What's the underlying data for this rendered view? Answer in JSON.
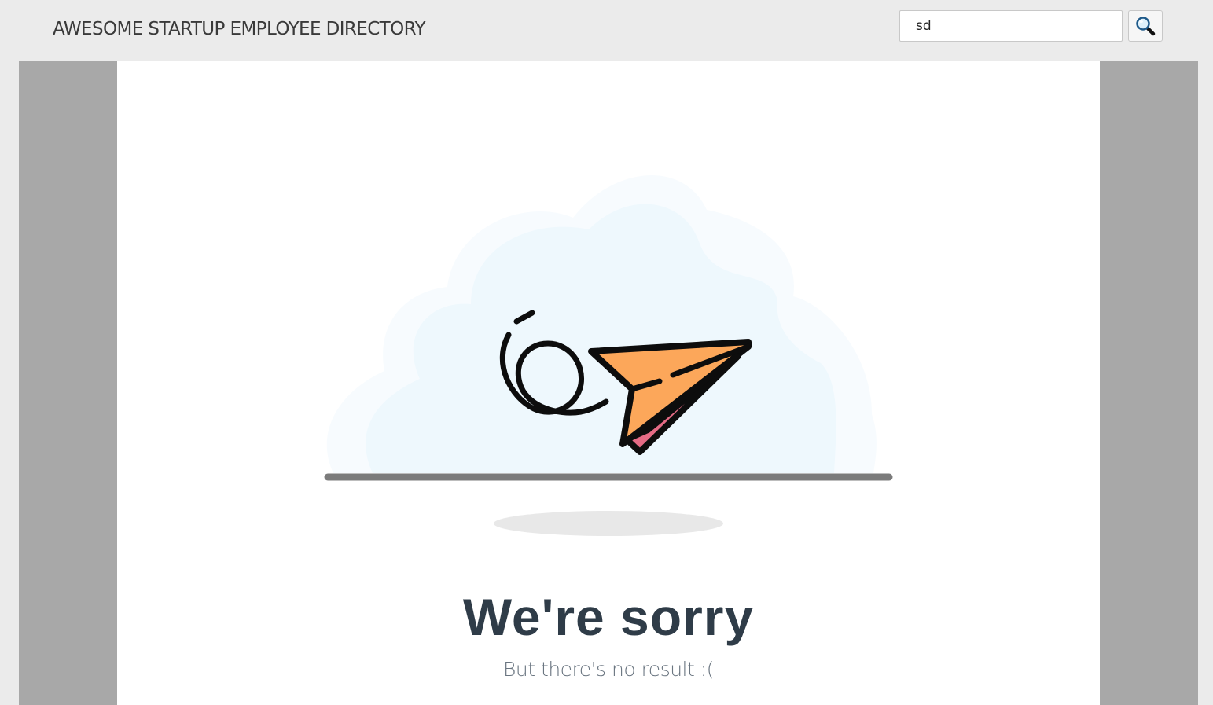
{
  "header": {
    "title": "AWESOME STARTUP EMPLOYEE DIRECTORY"
  },
  "search": {
    "value": "sd",
    "button_icon": "magnifier-icon"
  },
  "empty_state": {
    "illustration": "paper-plane-illustration",
    "title": "We're sorry",
    "subtitle": "But there's no result :("
  },
  "colors": {
    "background": "#ebebeb",
    "side_gutter": "#a8a8a8",
    "panel": "#ffffff",
    "cloud": "#eef8fd",
    "plane": "#fca75a",
    "plane_fold": "#e56b85",
    "title_text": "#2f3c48",
    "subtitle_text": "#6a7580"
  }
}
